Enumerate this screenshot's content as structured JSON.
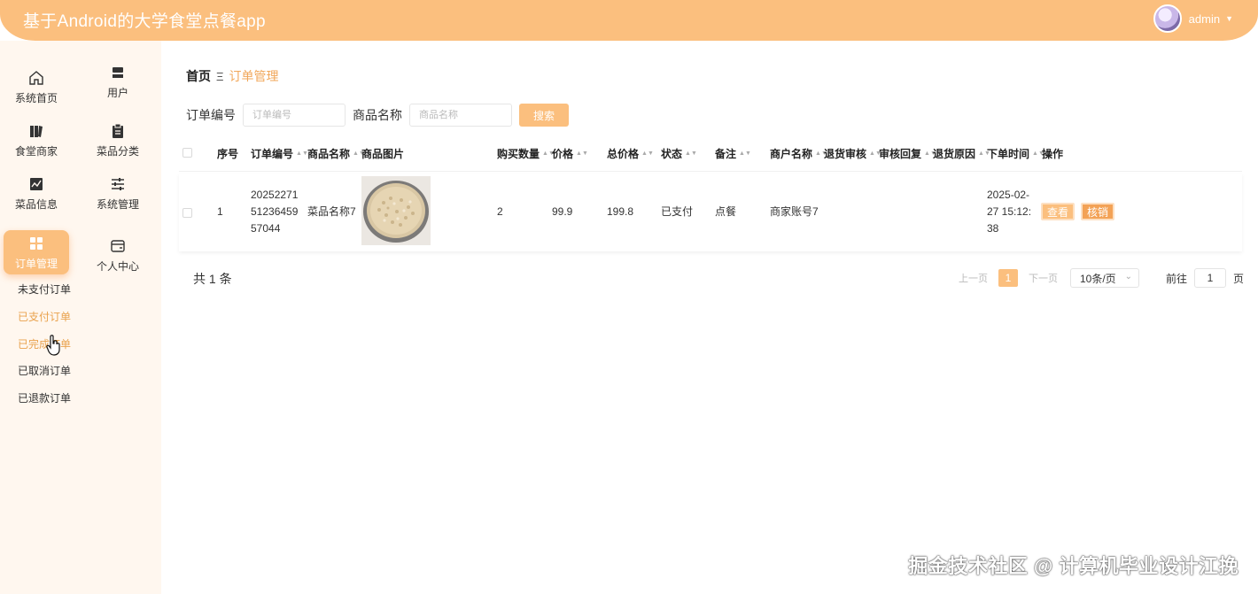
{
  "header": {
    "app_title": "基于Android的大学食堂点餐app",
    "user_name": "admin"
  },
  "sidebar": {
    "items": [
      {
        "label": "系统首页",
        "icon": "home-icon"
      },
      {
        "label": "用户",
        "icon": "user-icon"
      },
      {
        "label": "食堂商家",
        "icon": "shop-icon"
      },
      {
        "label": "菜品分类",
        "icon": "clipboard-icon"
      },
      {
        "label": "菜品信息",
        "icon": "chart-icon"
      },
      {
        "label": "系统管理",
        "icon": "sliders-icon"
      },
      {
        "label": "订单管理",
        "icon": "grid-icon"
      },
      {
        "label": "个人中心",
        "icon": "card-icon"
      }
    ],
    "sub_items": [
      "未支付订单",
      "已支付订单",
      "已完成订单",
      "已取消订单",
      "已退款订单"
    ]
  },
  "breadcrumb": {
    "home": "首页",
    "separator": "Ξ",
    "current": "订单管理"
  },
  "search": {
    "order_no_label": "订单编号",
    "order_no_placeholder": "订单编号",
    "product_label": "商品名称",
    "product_placeholder": "商品名称",
    "search_button": "搜索"
  },
  "table": {
    "columns": [
      "序号",
      "订单编号",
      "商品名称",
      "商品图片",
      "购买数量",
      "价格",
      "总价格",
      "状态",
      "备注",
      "商户名称",
      "退货审核",
      "审核回复",
      "退货原因",
      "下单时间",
      "操作"
    ],
    "rows": [
      {
        "index": "1",
        "order_no_lines": [
          "20252271",
          "51236459",
          "57044"
        ],
        "product_name": "菜品名称7",
        "quantity": "2",
        "price": "99.9",
        "total": "199.8",
        "status": "已支付",
        "remark": "点餐",
        "merchant": "商家账号7",
        "order_time_lines": [
          "2025-02-",
          "27 15:12:",
          "38"
        ],
        "actions": {
          "view": "查看",
          "verify": "核销"
        }
      }
    ]
  },
  "pagination": {
    "total_text": "共 1 条",
    "prev": "上一页",
    "current_page": "1",
    "next": "下一页",
    "page_size": "10条/页",
    "goto_prefix": "前往",
    "goto_value": "1",
    "goto_suffix": "页"
  },
  "watermark": "掘金技术社区 @ 计算机毕业设计江挽",
  "colors": {
    "accent": "#fbbf7e",
    "accent_dark": "#f3a256",
    "sidebar_bg": "#fff7ef"
  }
}
